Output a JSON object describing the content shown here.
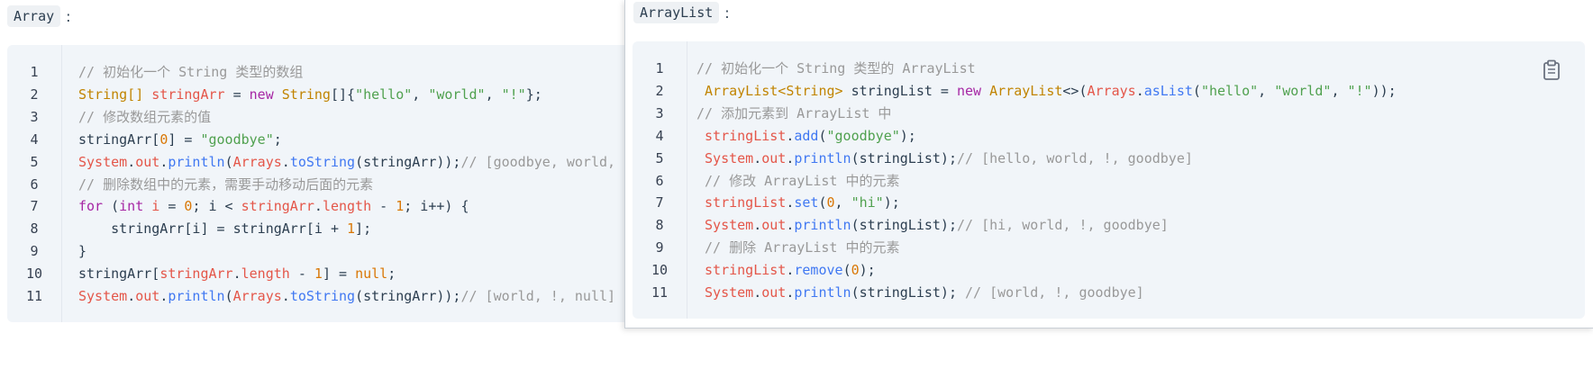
{
  "left": {
    "label": "Array",
    "colon": ":",
    "line_numbers": [
      "1",
      "2",
      "3",
      "4",
      "5",
      "6",
      "7",
      "8",
      "9",
      "10",
      "11"
    ],
    "lines": [
      [
        {
          "t": "// 初始化一个 String 类型的数组",
          "c": "c"
        }
      ],
      [
        {
          "t": "String[]",
          "c": "t"
        },
        {
          "t": " ",
          "c": "p"
        },
        {
          "t": "stringArr",
          "c": "v"
        },
        {
          "t": " = ",
          "c": "p"
        },
        {
          "t": "new",
          "c": "k"
        },
        {
          "t": " ",
          "c": "p"
        },
        {
          "t": "String",
          "c": "t"
        },
        {
          "t": "[]{",
          "c": "p"
        },
        {
          "t": "\"hello\"",
          "c": "s"
        },
        {
          "t": ", ",
          "c": "p"
        },
        {
          "t": "\"world\"",
          "c": "s"
        },
        {
          "t": ", ",
          "c": "p"
        },
        {
          "t": "\"!\"",
          "c": "s"
        },
        {
          "t": "};",
          "c": "p"
        }
      ],
      [
        {
          "t": "// 修改数组元素的值",
          "c": "c"
        }
      ],
      [
        {
          "t": "stringArr[",
          "c": "p"
        },
        {
          "t": "0",
          "c": "n"
        },
        {
          "t": "] = ",
          "c": "p"
        },
        {
          "t": "\"goodbye\"",
          "c": "s"
        },
        {
          "t": ";",
          "c": "p"
        }
      ],
      [
        {
          "t": "System",
          "c": "v"
        },
        {
          "t": ".",
          "c": "p"
        },
        {
          "t": "out",
          "c": "v"
        },
        {
          "t": ".",
          "c": "p"
        },
        {
          "t": "println",
          "c": "m"
        },
        {
          "t": "(",
          "c": "p"
        },
        {
          "t": "Arrays",
          "c": "v"
        },
        {
          "t": ".",
          "c": "p"
        },
        {
          "t": "toString",
          "c": "m"
        },
        {
          "t": "(stringArr));",
          "c": "p"
        },
        {
          "t": "// [goodbye, world, !]",
          "c": "c"
        }
      ],
      [
        {
          "t": "// 删除数组中的元素，需要手动移动后面的元素",
          "c": "c"
        }
      ],
      [
        {
          "t": "for",
          "c": "k"
        },
        {
          "t": " (",
          "c": "p"
        },
        {
          "t": "int",
          "c": "k"
        },
        {
          "t": " ",
          "c": "p"
        },
        {
          "t": "i",
          "c": "v"
        },
        {
          "t": " = ",
          "c": "p"
        },
        {
          "t": "0",
          "c": "n"
        },
        {
          "t": "; i < ",
          "c": "p"
        },
        {
          "t": "stringArr",
          "c": "v"
        },
        {
          "t": ".",
          "c": "p"
        },
        {
          "t": "length",
          "c": "v"
        },
        {
          "t": " - ",
          "c": "p"
        },
        {
          "t": "1",
          "c": "n"
        },
        {
          "t": "; i++) {",
          "c": "p"
        }
      ],
      [
        {
          "t": "    stringArr[i] = stringArr[i + ",
          "c": "p"
        },
        {
          "t": "1",
          "c": "n"
        },
        {
          "t": "];",
          "c": "p"
        }
      ],
      [
        {
          "t": "}",
          "c": "p"
        }
      ],
      [
        {
          "t": "stringArr[",
          "c": "p"
        },
        {
          "t": "stringArr",
          "c": "v"
        },
        {
          "t": ".",
          "c": "p"
        },
        {
          "t": "length",
          "c": "v"
        },
        {
          "t": " - ",
          "c": "p"
        },
        {
          "t": "1",
          "c": "n"
        },
        {
          "t": "] = ",
          "c": "p"
        },
        {
          "t": "null",
          "c": "n"
        },
        {
          "t": ";",
          "c": "p"
        }
      ],
      [
        {
          "t": "System",
          "c": "v"
        },
        {
          "t": ".",
          "c": "p"
        },
        {
          "t": "out",
          "c": "v"
        },
        {
          "t": ".",
          "c": "p"
        },
        {
          "t": "println",
          "c": "m"
        },
        {
          "t": "(",
          "c": "p"
        },
        {
          "t": "Arrays",
          "c": "v"
        },
        {
          "t": ".",
          "c": "p"
        },
        {
          "t": "toString",
          "c": "m"
        },
        {
          "t": "(stringArr));",
          "c": "p"
        },
        {
          "t": "// [world, !, null]",
          "c": "c"
        }
      ]
    ]
  },
  "right": {
    "label": "ArrayList",
    "colon": ":",
    "copy_icon": "clipboard-icon",
    "line_numbers": [
      "1",
      "2",
      "3",
      "4",
      "5",
      "6",
      "7",
      "8",
      "9",
      "10",
      "11"
    ],
    "lines": [
      [
        {
          "t": "// 初始化一个 String 类型的 ArrayList",
          "c": "c"
        }
      ],
      [
        {
          "t": " ",
          "c": "p"
        },
        {
          "t": "ArrayList<String>",
          "c": "t"
        },
        {
          "t": " stringList = ",
          "c": "p"
        },
        {
          "t": "new",
          "c": "k"
        },
        {
          "t": " ",
          "c": "p"
        },
        {
          "t": "ArrayList",
          "c": "t"
        },
        {
          "t": "<>(",
          "c": "p"
        },
        {
          "t": "Arrays",
          "c": "v"
        },
        {
          "t": ".",
          "c": "p"
        },
        {
          "t": "asList",
          "c": "m"
        },
        {
          "t": "(",
          "c": "p"
        },
        {
          "t": "\"hello\"",
          "c": "s"
        },
        {
          "t": ", ",
          "c": "p"
        },
        {
          "t": "\"world\"",
          "c": "s"
        },
        {
          "t": ", ",
          "c": "p"
        },
        {
          "t": "\"!\"",
          "c": "s"
        },
        {
          "t": "));",
          "c": "p"
        }
      ],
      [
        {
          "t": "// 添加元素到 ArrayList 中",
          "c": "c"
        }
      ],
      [
        {
          "t": " ",
          "c": "p"
        },
        {
          "t": "stringList",
          "c": "v"
        },
        {
          "t": ".",
          "c": "p"
        },
        {
          "t": "add",
          "c": "m"
        },
        {
          "t": "(",
          "c": "p"
        },
        {
          "t": "\"goodbye\"",
          "c": "s"
        },
        {
          "t": ");",
          "c": "p"
        }
      ],
      [
        {
          "t": " ",
          "c": "p"
        },
        {
          "t": "System",
          "c": "v"
        },
        {
          "t": ".",
          "c": "p"
        },
        {
          "t": "out",
          "c": "v"
        },
        {
          "t": ".",
          "c": "p"
        },
        {
          "t": "println",
          "c": "m"
        },
        {
          "t": "(stringList);",
          "c": "p"
        },
        {
          "t": "// [hello, world, !, goodbye]",
          "c": "c"
        }
      ],
      [
        {
          "t": " // 修改 ArrayList 中的元素",
          "c": "c"
        }
      ],
      [
        {
          "t": " ",
          "c": "p"
        },
        {
          "t": "stringList",
          "c": "v"
        },
        {
          "t": ".",
          "c": "p"
        },
        {
          "t": "set",
          "c": "m"
        },
        {
          "t": "(",
          "c": "p"
        },
        {
          "t": "0",
          "c": "n"
        },
        {
          "t": ", ",
          "c": "p"
        },
        {
          "t": "\"hi\"",
          "c": "s"
        },
        {
          "t": ");",
          "c": "p"
        }
      ],
      [
        {
          "t": " ",
          "c": "p"
        },
        {
          "t": "System",
          "c": "v"
        },
        {
          "t": ".",
          "c": "p"
        },
        {
          "t": "out",
          "c": "v"
        },
        {
          "t": ".",
          "c": "p"
        },
        {
          "t": "println",
          "c": "m"
        },
        {
          "t": "(stringList);",
          "c": "p"
        },
        {
          "t": "// [hi, world, !, goodbye]",
          "c": "c"
        }
      ],
      [
        {
          "t": " // 删除 ArrayList 中的元素",
          "c": "c"
        }
      ],
      [
        {
          "t": " ",
          "c": "p"
        },
        {
          "t": "stringList",
          "c": "v"
        },
        {
          "t": ".",
          "c": "p"
        },
        {
          "t": "remove",
          "c": "m"
        },
        {
          "t": "(",
          "c": "p"
        },
        {
          "t": "0",
          "c": "n"
        },
        {
          "t": ");",
          "c": "p"
        }
      ],
      [
        {
          "t": " ",
          "c": "p"
        },
        {
          "t": "System",
          "c": "v"
        },
        {
          "t": ".",
          "c": "p"
        },
        {
          "t": "out",
          "c": "v"
        },
        {
          "t": ".",
          "c": "p"
        },
        {
          "t": "println",
          "c": "m"
        },
        {
          "t": "(stringList); ",
          "c": "p"
        },
        {
          "t": "// [world, !, goodbye]",
          "c": "c"
        }
      ]
    ]
  }
}
